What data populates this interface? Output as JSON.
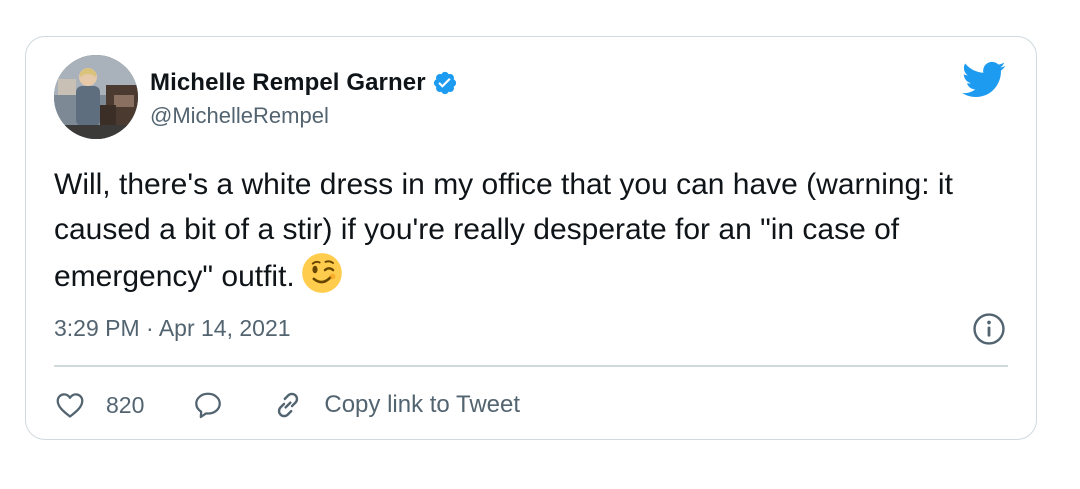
{
  "tweet": {
    "author": {
      "display_name": "Michelle Rempel Garner",
      "handle": "@MichelleRempel",
      "verified": true
    },
    "text": "Will, there's a white dress in my office that you can have (warning: it caused a bit of a stir) if you're really desperate for an \"in case of emergency\" outfit.",
    "emoji": "winking-face",
    "timestamp": "3:29 PM · Apr 14, 2021",
    "likes": "820",
    "copy_link_label": "Copy link to Tweet"
  },
  "colors": {
    "accent": "#1d9bf0",
    "text": "#0f1419",
    "secondary_text": "#536471",
    "border": "#cfd9de",
    "emoji_face": "#ffcc4d"
  },
  "icons": [
    "verified-badge-icon",
    "twitter-bird-icon",
    "info-icon",
    "heart-icon",
    "reply-icon",
    "link-icon",
    "wink-emoji-icon"
  ]
}
